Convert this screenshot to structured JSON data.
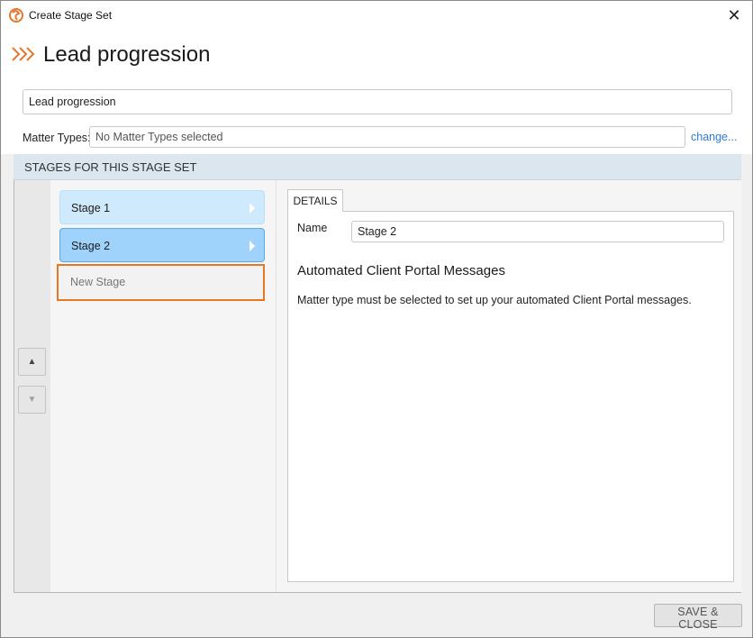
{
  "window": {
    "title": "Create Stage Set",
    "close_glyph": "✕",
    "icon": "app-logo-icon"
  },
  "header": {
    "title": "Lead progression",
    "icon": "double-chevron-right-icon"
  },
  "form": {
    "name_value": "Lead progression",
    "matter_types_label": "Matter Types:",
    "matter_types_value": "No Matter Types selected",
    "change_link": "change..."
  },
  "stages_section": {
    "header": "STAGES FOR THIS STAGE SET",
    "move_up_glyph": "▲",
    "move_down_glyph": "▼",
    "items": [
      {
        "label": "Stage 1",
        "selected": false
      },
      {
        "label": "Stage 2",
        "selected": true
      }
    ],
    "new_stage_placeholder": "New Stage"
  },
  "details": {
    "tab_label": "DETAILS",
    "name_label": "Name",
    "name_value": "Stage 2",
    "portal_heading": "Automated Client Portal Messages",
    "portal_message": "Matter type must be selected to set up your automated Client Portal messages."
  },
  "footer": {
    "save_close_label": "SAVE & CLOSE"
  },
  "colors": {
    "accent_orange": "#e87722",
    "link_blue": "#2c7bd6",
    "stage_selected": "#9fd3fb",
    "stage_default": "#cfe9fd",
    "section_header": "#dbe6ee"
  }
}
